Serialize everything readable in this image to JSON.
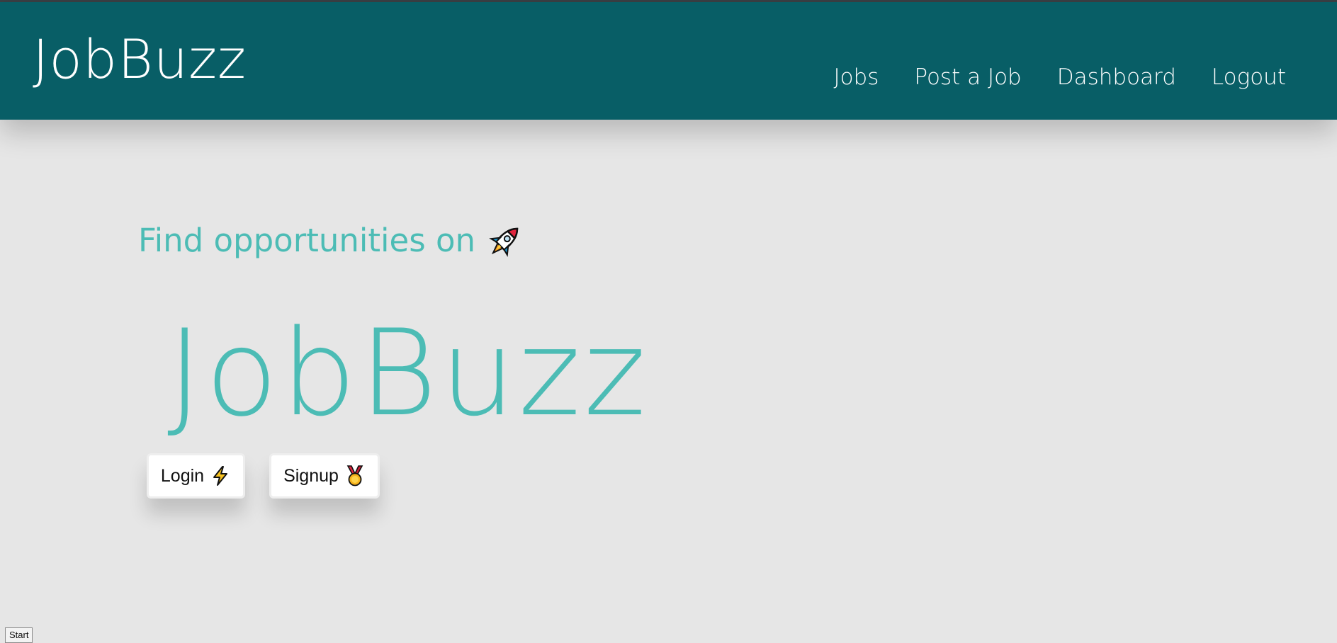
{
  "header": {
    "brand": "JobBuzz",
    "nav": {
      "jobs": "Jobs",
      "post_job": "Post a Job",
      "dashboard": "Dashboard",
      "logout": "Logout"
    }
  },
  "hero": {
    "subtitle": "Find opportunities on",
    "subtitle_icon": "rocket-icon",
    "title": "JobBuzz"
  },
  "actions": {
    "login_label": "Login",
    "login_icon": "lightning-icon",
    "signup_label": "Signup",
    "signup_icon": "medal-icon"
  },
  "status_bar": {
    "start_label": "Start"
  },
  "colors": {
    "navbar": "#085e66",
    "accent": "#4cbcb5",
    "background": "#e6e6e6"
  }
}
